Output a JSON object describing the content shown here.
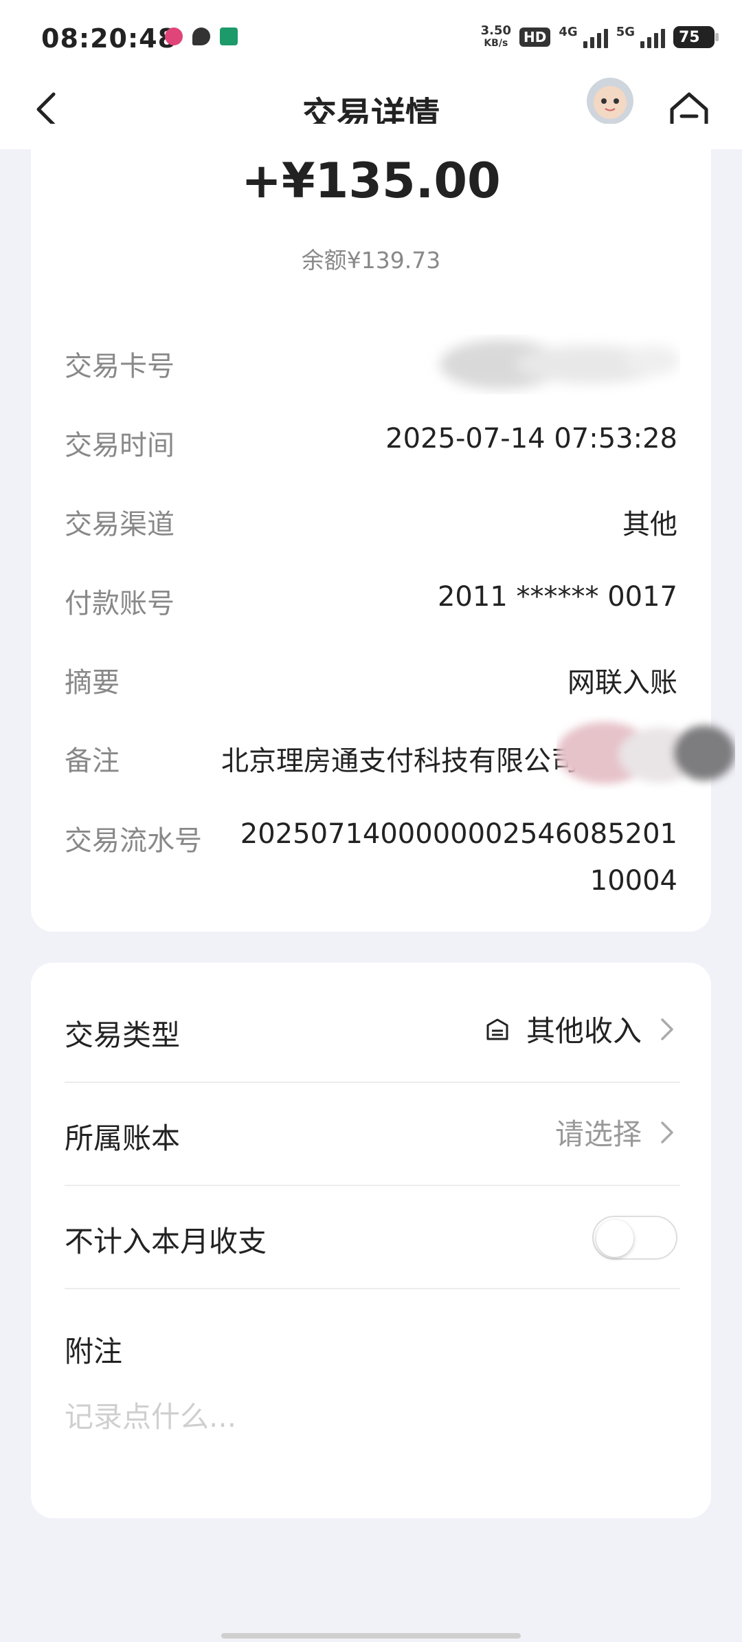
{
  "status_bar": {
    "time": "08:20:48",
    "speed_value": "3.50",
    "speed_unit": "KB/s",
    "hd_label": "HD",
    "net1": "4G",
    "net2": "5G",
    "battery": "75"
  },
  "nav": {
    "title": "交易详情"
  },
  "summary": {
    "amount": "+¥135.00",
    "balance": "余额¥139.73"
  },
  "details": {
    "card_label": "交易卡号",
    "time_label": "交易时间",
    "time_value": "2025-07-14 07:53:28",
    "channel_label": "交易渠道",
    "channel_value": "其他",
    "payer_label": "付款账号",
    "payer_value": "2011 ****** 0017",
    "summary_label": "摘要",
    "summary_value": "网联入账",
    "note_label": "备注",
    "note_value": "北京理房通支付科技有限公司",
    "serial_label": "交易流水号",
    "serial_line1": "2025071400000002546085201",
    "serial_line2": "10004"
  },
  "settings": {
    "type_label": "交易类型",
    "type_value": "其他收入",
    "book_label": "所属账本",
    "book_value": "请选择",
    "exclude_label": "不计入本月收支",
    "exclude_enabled": false,
    "memo_label": "附注",
    "memo_placeholder": "记录点什么..."
  },
  "colors": {
    "page_bg": "#f1f1f8",
    "card_bg": "#ffffff",
    "label_gray": "#888888",
    "text_dark": "#222222"
  }
}
